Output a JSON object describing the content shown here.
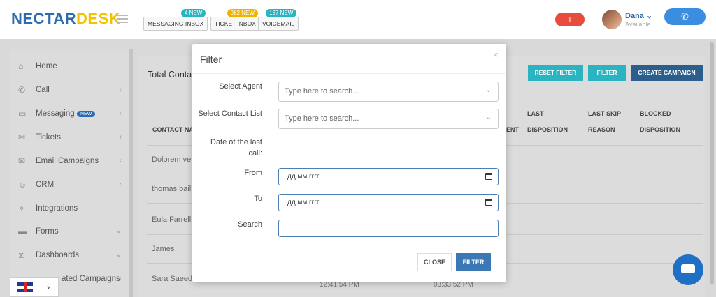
{
  "brand": {
    "logo_text": "NECTARDESK"
  },
  "header": {
    "inboxes": [
      {
        "label": "MESSAGING INBOX",
        "badge": "4 NEW",
        "badge_color": "#2ab3c0"
      },
      {
        "label": "TICKET INBOX",
        "badge": "962 NEW",
        "badge_color": "#f0b400"
      },
      {
        "label": "VOICEMAIL",
        "badge": "167 NEW",
        "badge_color": "#2ab3c0"
      }
    ],
    "add_label": "+",
    "user": {
      "name": "Dana",
      "status": "Available"
    },
    "call_label": "✆"
  },
  "sidebar": {
    "items": [
      {
        "label": "Home",
        "icon": "home-icon",
        "glyph": "⌂",
        "chevron": ""
      },
      {
        "label": "Call",
        "icon": "phone-icon",
        "glyph": "✆",
        "chevron": "‹"
      },
      {
        "label": "Messaging",
        "icon": "message-icon",
        "glyph": "▭",
        "chevron": "‹",
        "pill": "NEW"
      },
      {
        "label": "Tickets",
        "icon": "envelope-icon",
        "glyph": "✉",
        "chevron": "‹"
      },
      {
        "label": "Email Campaigns",
        "icon": "envelope-icon",
        "glyph": "✉",
        "chevron": "‹"
      },
      {
        "label": "CRM",
        "icon": "user-icon",
        "glyph": "☺",
        "chevron": "‹"
      },
      {
        "label": "Integrations",
        "icon": "puzzle-icon",
        "glyph": "✧",
        "chevron": ""
      },
      {
        "label": "Forms",
        "icon": "folder-icon",
        "glyph": "▬",
        "chevron": "⌄"
      },
      {
        "label": "Dashboards",
        "icon": "hourglass-icon",
        "glyph": "⧖",
        "chevron": "⌄"
      },
      {
        "label": "ated Campaigns",
        "icon": "campaign-icon",
        "glyph": "",
        "chevron": "‹"
      }
    ]
  },
  "language": {
    "arrow": "›"
  },
  "main": {
    "title": "Total Conta",
    "buttons": [
      {
        "label": "RESET FILTER",
        "color": "#2ab3c0"
      },
      {
        "label": "FILTER",
        "color": "#2ab3c0"
      },
      {
        "label": "CREATE CAMPAIGN",
        "color": "#2b5e8c"
      }
    ],
    "columns": {
      "contact": "CONTACT NA",
      "ent": "ENT",
      "last_disposition": [
        "LAST",
        "DISPOSITION"
      ],
      "last_skip": [
        "LAST SKIP",
        "REASON"
      ],
      "blocked": [
        "BLOCKED",
        "DISPOSITION"
      ]
    },
    "rows": [
      "Dolorem ve",
      "thomas bail",
      "Eula Farrell",
      "James",
      "Sara Saeed"
    ],
    "times": [
      "12:41:54 PM",
      "03:33:52 PM"
    ]
  },
  "modal": {
    "title": "Filter",
    "close_x": "×",
    "agent_label": "Select Agent",
    "agent_placeholder": "Type here to search...",
    "contact_list_label": "Select Contact List",
    "contact_list_placeholder": "Type here to search...",
    "date_label_line1": "Date of the last",
    "date_label_line2": "call:",
    "from_label": "From",
    "from_placeholder": "дд.мм.гггг",
    "to_label": "To",
    "to_placeholder": "дд.мм.гггг",
    "search_label": "Search",
    "close_button": "CLOSE",
    "filter_button": "FILTER"
  }
}
